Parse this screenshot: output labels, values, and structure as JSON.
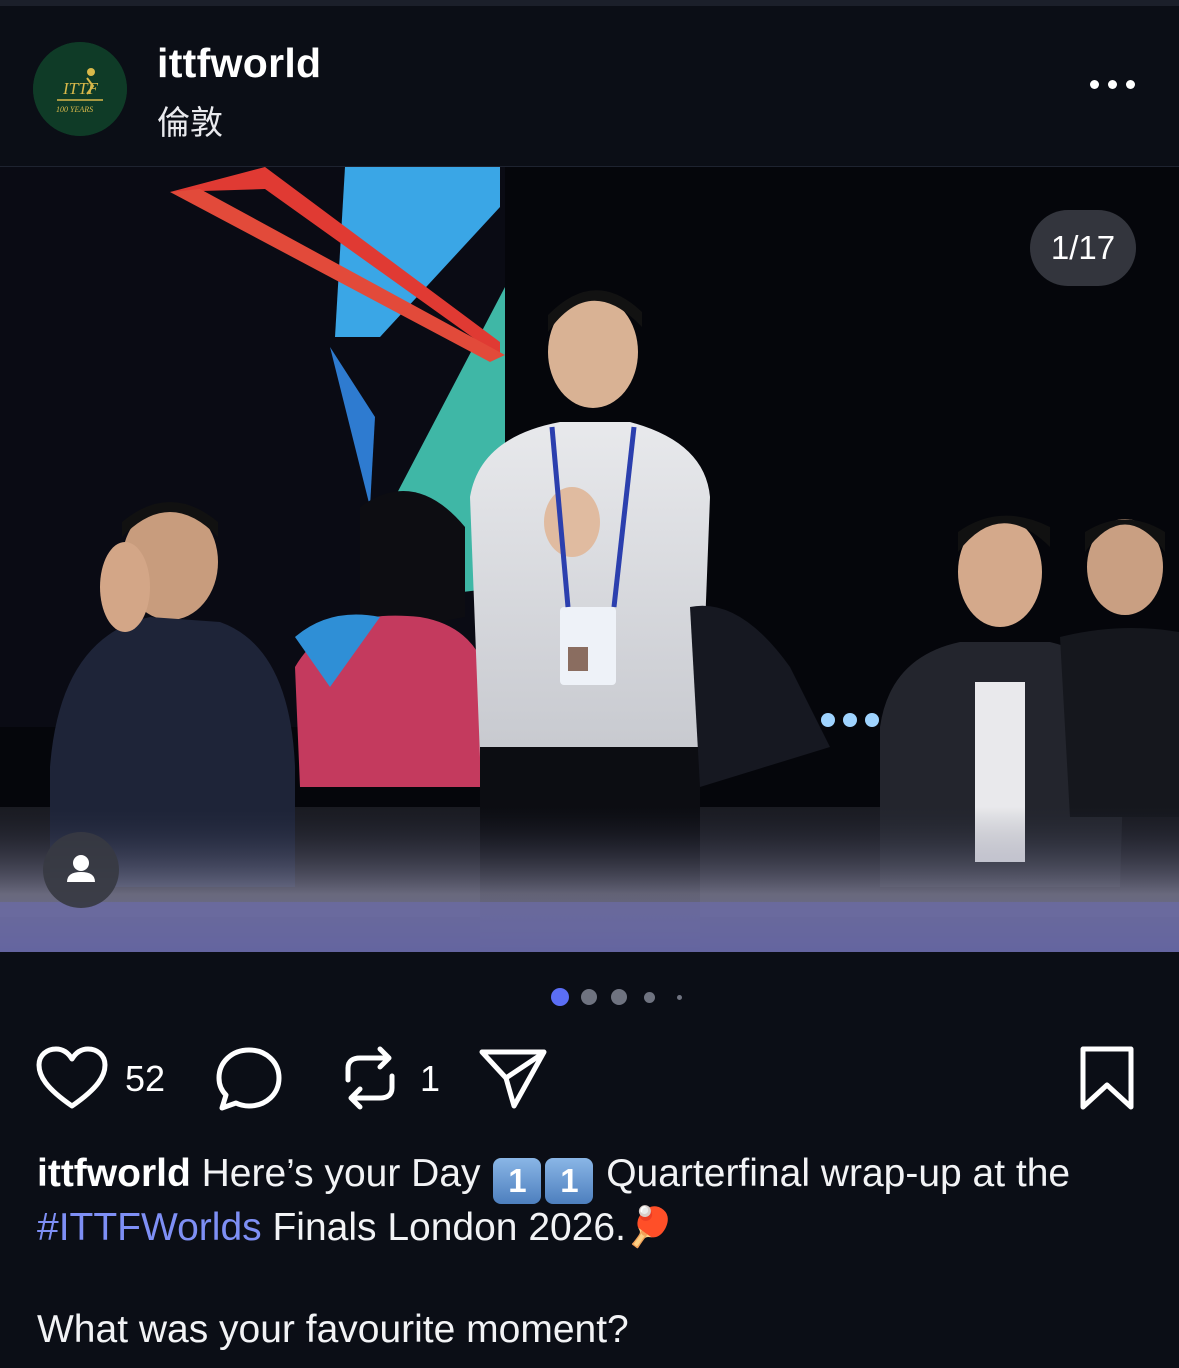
{
  "post": {
    "username": "ittfworld",
    "location": "倫敦",
    "avatar_text_top": "ITTF",
    "avatar_text_bottom": "100 YEARS",
    "more_icon": "more-horizontal-icon"
  },
  "media": {
    "counter": "1/17",
    "slides_dots": 5,
    "active_dot": 0,
    "accent_color": "#5b6ef5",
    "user_tag_icon": "person-icon",
    "photo_description_tags": []
  },
  "actions": {
    "like_icon": "heart-icon",
    "like_count": "52",
    "comment_icon": "comment-bubble-icon",
    "repost_icon": "repost-icon",
    "repost_count": "1",
    "share_icon": "paper-plane-icon",
    "save_icon": "bookmark-icon"
  },
  "caption": {
    "username": "ittfworld",
    "text_before": "Here’s your Day",
    "keycap_1": "1",
    "keycap_2": "1",
    "text_after": "Quarterfinal wrap-up at the",
    "hashtag": "#ITTFWorlds",
    "text_end": "Finals London 2026.",
    "emoji": "🏓",
    "question": "What was your favourite moment?"
  }
}
